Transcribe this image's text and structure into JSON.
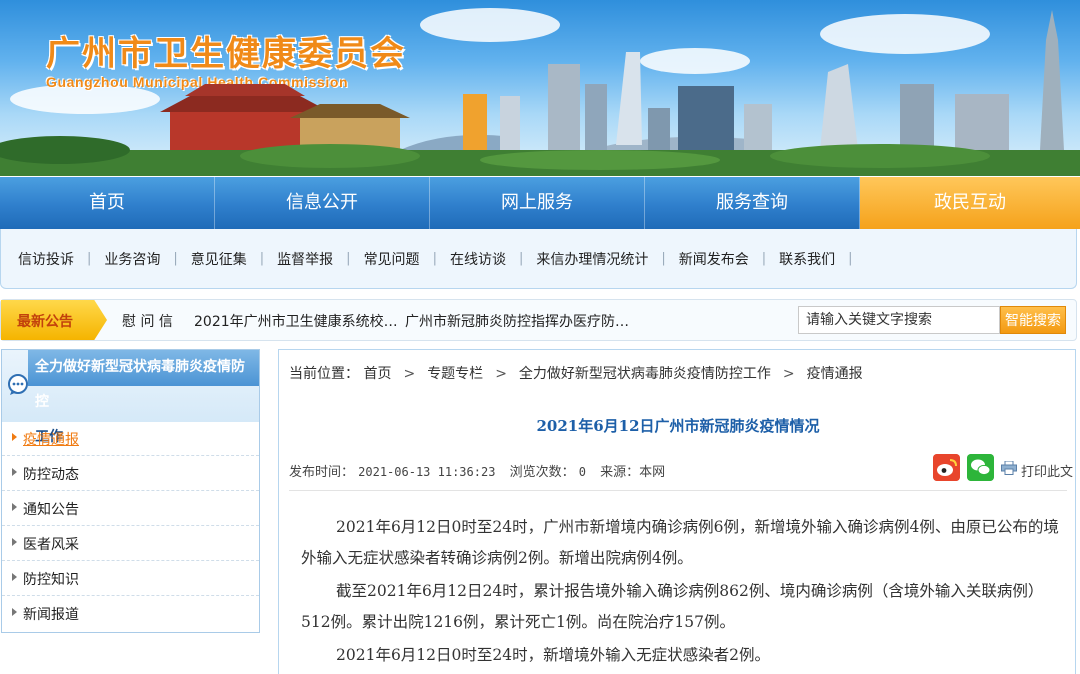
{
  "banner": {
    "title_cn": "广州市卫生健康委员会",
    "title_en": "Guangzhou Municipal Health Commission"
  },
  "main_nav": [
    {
      "label": "首页"
    },
    {
      "label": "信息公开"
    },
    {
      "label": "网上服务"
    },
    {
      "label": "服务查询"
    },
    {
      "label": "政民互动",
      "active": true
    }
  ],
  "sub_nav": [
    {
      "label": "信访投诉"
    },
    {
      "label": "业务咨询"
    },
    {
      "label": "意见征集"
    },
    {
      "label": "监督举报"
    },
    {
      "label": "常见问题"
    },
    {
      "label": "在线访谈"
    },
    {
      "label": "来信办理情况统计"
    },
    {
      "label": "新闻发布会"
    },
    {
      "label": "联系我们"
    }
  ],
  "notice": {
    "label": "最新公告",
    "items": [
      {
        "text": "慰 问 信"
      },
      {
        "text": "2021年广州市卫生健康系统校…"
      },
      {
        "text": "广州市新冠肺炎防控指挥办医疗防…"
      }
    ]
  },
  "search": {
    "placeholder": "请输入关键文字搜索",
    "button_label": "智能搜索"
  },
  "sidebar": {
    "heading_line1": "全力做好新型冠状病毒肺炎疫情防控",
    "heading_line2": "工作",
    "items": [
      {
        "label": "疫情通报",
        "active": true
      },
      {
        "label": "防控动态"
      },
      {
        "label": "通知公告"
      },
      {
        "label": "医者风采"
      },
      {
        "label": "防控知识"
      },
      {
        "label": "新闻报道"
      }
    ]
  },
  "breadcrumb": {
    "prefix": "当前位置：",
    "items": [
      {
        "label": "首页"
      },
      {
        "label": "专题专栏"
      },
      {
        "label": "全力做好新型冠状病毒肺炎疫情防控工作"
      },
      {
        "label": "疫情通报"
      }
    ]
  },
  "article": {
    "title": "2021年6月12日广州市新冠肺炎疫情情况",
    "meta": {
      "publish_label": "发布时间：",
      "publish_time": "2021-06-13 11:36:23",
      "views_label": "浏览次数：",
      "views": "0",
      "source_label": "来源：",
      "source": "本网"
    },
    "print_label": "打印此文",
    "paragraphs": [
      "2021年6月12日0时至24时，广州市新增境内确诊病例6例，新增境外输入确诊病例4例、由原已公布的境外输入无症状感染者转确诊病例2例。新增出院病例4例。",
      "截至2021年6月12日24时，累计报告境外输入确诊病例862例、境内确诊病例（含境外输入关联病例）512例。累计出院1216例，累计死亡1例。尚在院治疗157例。",
      "2021年6月12日0时至24时，新增境外输入无症状感染者2例。"
    ]
  },
  "colors": {
    "nav_blue": "#2f7fcc",
    "nav_active_orange": "#f5a21b",
    "title_blue": "#1d5fa8",
    "active_link_orange": "#f07b12",
    "brand_orange": "#f08a18"
  },
  "icons": {
    "notice": "arrow-tag-icon",
    "sidebar_heading": "chat-bubble-icon",
    "share_weibo": "weibo-icon",
    "share_wechat": "wechat-icon",
    "print": "printer-icon",
    "list_bullet": "triangle-right-icon"
  }
}
